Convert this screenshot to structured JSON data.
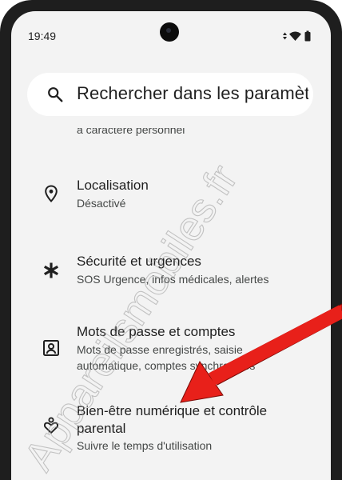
{
  "status_bar": {
    "time": "19:49",
    "icons": [
      "data-arrows-icon",
      "wifi-icon",
      "battery-icon"
    ]
  },
  "search": {
    "text": "Rechercher dans les paramètres"
  },
  "partial_item": {
    "subtitle": "à caractère personnel"
  },
  "settings_items": [
    {
      "icon": "location-pin-icon",
      "title": "Localisation",
      "subtitle": "Désactivé"
    },
    {
      "icon": "asterisk-icon",
      "title": "Sécurité et urgences",
      "subtitle": "SOS Urgence, infos médicales, alertes"
    },
    {
      "icon": "account-box-icon",
      "title": "Mots de passe et comptes",
      "subtitle": "Mots de passe enregistrés, saisie automatique, comptes synchronisés"
    },
    {
      "icon": "heart-person-icon",
      "title": "Bien-être numérique et contrôle parental",
      "subtitle": "Suivre le temps d'utilisation"
    }
  ],
  "watermark": {
    "text": "Appareilsmobiles.fr"
  },
  "colors": {
    "screen_bg": "#f3f3f3",
    "frame": "#1e1e1e",
    "arrow": "#e8201a"
  }
}
